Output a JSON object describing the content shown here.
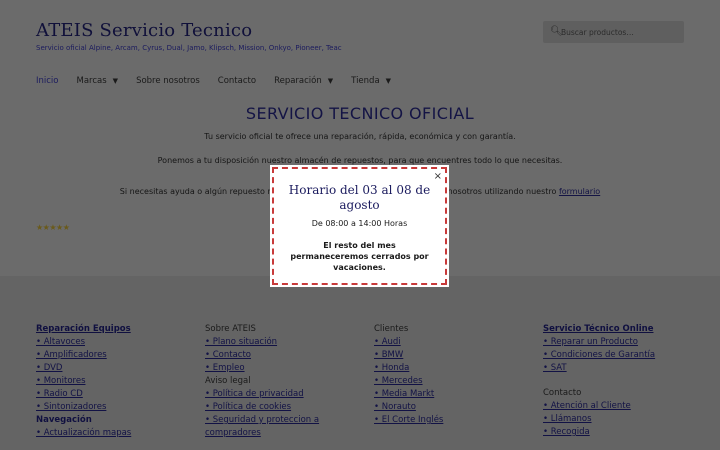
{
  "header": {
    "title": "ATEIS Servicio Tecnico",
    "tagline": "Servicio oficial Alpine, Arcam, Cyrus, Dual, Jamo, Klipsch, Mission, Onkyo, Pioneer, Teac",
    "search_placeholder": "Buscar productos…"
  },
  "nav": {
    "items": [
      {
        "label": "Inicio"
      },
      {
        "label": "Marcas"
      },
      {
        "label": "Sobre nosotros"
      },
      {
        "label": "Contacto"
      },
      {
        "label": "Reparación"
      },
      {
        "label": "Tienda"
      }
    ]
  },
  "main": {
    "title": "SERVICIO TECNICO OFICIAL",
    "p1": "Tu servicio oficial te ofrece una reparación, rápida, económica y con garantía.",
    "p2": "Ponemos a tu disposición nuestro almacén de repuestos, para que encuentres todo lo que necesitas.",
    "p3_start": "Si necesitas ayuda o algún repuesto n",
    "p3_end": "nosotros utilizando nuestro",
    "p3_link": "formulario",
    "rating": "★★★★★"
  },
  "footer": {
    "col1": {
      "heading": "Reparación Equipos",
      "items": [
        "• Altavoces",
        "• Amplificadores",
        "• DVD",
        "• Monitores",
        "• Radio CD",
        "• Sintonizadores"
      ],
      "heading2": "Navegación",
      "items2": [
        "• Actualización mapas"
      ]
    },
    "col2": {
      "heading": "Sobre ATEIS",
      "items": [
        "• Plano situación",
        "• Contacto",
        "• Empleo"
      ],
      "heading2": "Aviso legal",
      "items2": [
        "• Política de privacidad",
        "• Política de cookies",
        "• Seguridad y proteccion a compradores"
      ]
    },
    "col3": {
      "heading": "Clientes",
      "items": [
        "• Audi",
        "• BMW",
        "• Honda",
        "• Mercedes",
        "• Media Markt",
        "• Norauto",
        "• El Corte Inglés"
      ]
    },
    "col4": {
      "heading": "Servicio Técnico Online",
      "items": [
        "• Reparar un Producto",
        "• Condiciones de Garantía",
        "• SAT"
      ],
      "heading2": "Contacto",
      "items2": [
        "• Atención al Cliente",
        "• Llámanos",
        "• Recogida"
      ]
    }
  },
  "modal": {
    "close": "×",
    "title": "Horario del 03 al 08 de agosto",
    "hours": "De 08:00 a 14:00 Horas",
    "note": "El resto del mes permaneceremos cerrados por vacaciones."
  },
  "colors": {
    "accent": "#1b1b5e",
    "modal_border": "#c83a3a"
  }
}
